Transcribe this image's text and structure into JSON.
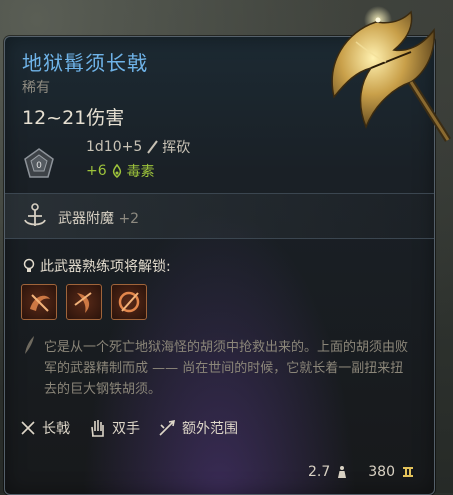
{
  "item": {
    "name": "地狱髯须长戟",
    "rarity": "稀有",
    "damage": "12~21伤害",
    "damage_roll": "1d10+5",
    "damage_type": "挥砍",
    "bonus_damage": "+6",
    "bonus_type": "毒素"
  },
  "enchant": {
    "label": "武器附魔",
    "value": "+2"
  },
  "mastery": {
    "label": "此武器熟练项将解锁:"
  },
  "description": "它是从一个死亡地狱海怪的胡须中抢救出来的。上面的胡须由败军的武器精制而成 —— 尚在世间的时候，它就长着一副扭来扭去的巨大钢铁胡须。",
  "properties": [
    {
      "label": "长戟",
      "icon": "halberd-icon"
    },
    {
      "label": "双手",
      "icon": "hand-icon"
    },
    {
      "label": "额外范围",
      "icon": "reach-icon"
    }
  ],
  "footer": {
    "weight": "2.7",
    "price": "380"
  },
  "colors": {
    "title": "#6fb3e8",
    "bonus": "#9ec43b"
  }
}
